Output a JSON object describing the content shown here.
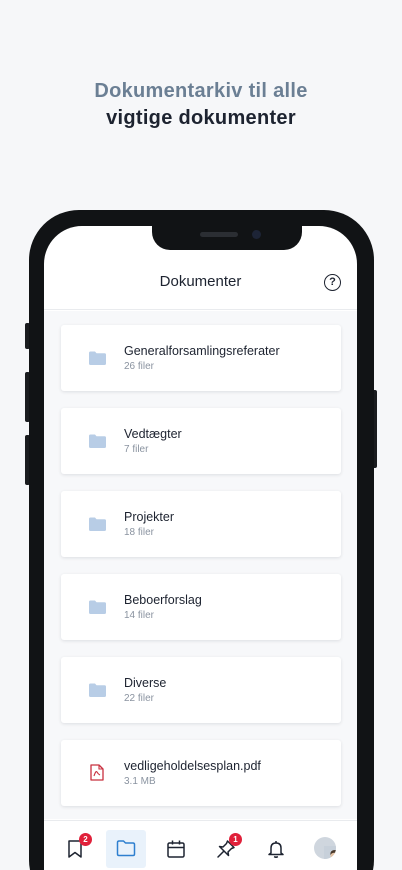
{
  "headline": {
    "line1": "Dokumentarkiv til alle",
    "line2": "vigtige dokumenter"
  },
  "header": {
    "title": "Dokumenter",
    "help_icon": "question-circle-icon",
    "help_glyph": "?"
  },
  "items": [
    {
      "name": "Generalforsamlingsreferater",
      "sub": "26 filer",
      "icon": "folder-icon"
    },
    {
      "name": "Vedtægter",
      "sub": "7 filer",
      "icon": "folder-icon"
    },
    {
      "name": "Projekter",
      "sub": "18 filer",
      "icon": "folder-icon"
    },
    {
      "name": "Beboerforslag",
      "sub": "14 filer",
      "icon": "folder-icon"
    },
    {
      "name": "Diverse",
      "sub": "22 filer",
      "icon": "folder-icon"
    },
    {
      "name": "vedligeholdelsesplan.pdf",
      "sub": "3.1 MB",
      "icon": "pdf-file-icon"
    }
  ],
  "tabbar": {
    "tabs": [
      {
        "icon": "bookmark-icon",
        "badge": "2"
      },
      {
        "icon": "folder-icon",
        "active": true
      },
      {
        "icon": "calendar-icon"
      },
      {
        "icon": "pin-icon",
        "badge": "1"
      },
      {
        "icon": "bell-icon"
      },
      {
        "icon": "avatar"
      }
    ]
  },
  "colors": {
    "headline_accent": "#6b7f94",
    "headline_dark": "#1d2330",
    "folder": "#b8cde6",
    "pdf": "#c8303f",
    "active_tab": "#e9f2fb",
    "badge": "#e0203a"
  }
}
